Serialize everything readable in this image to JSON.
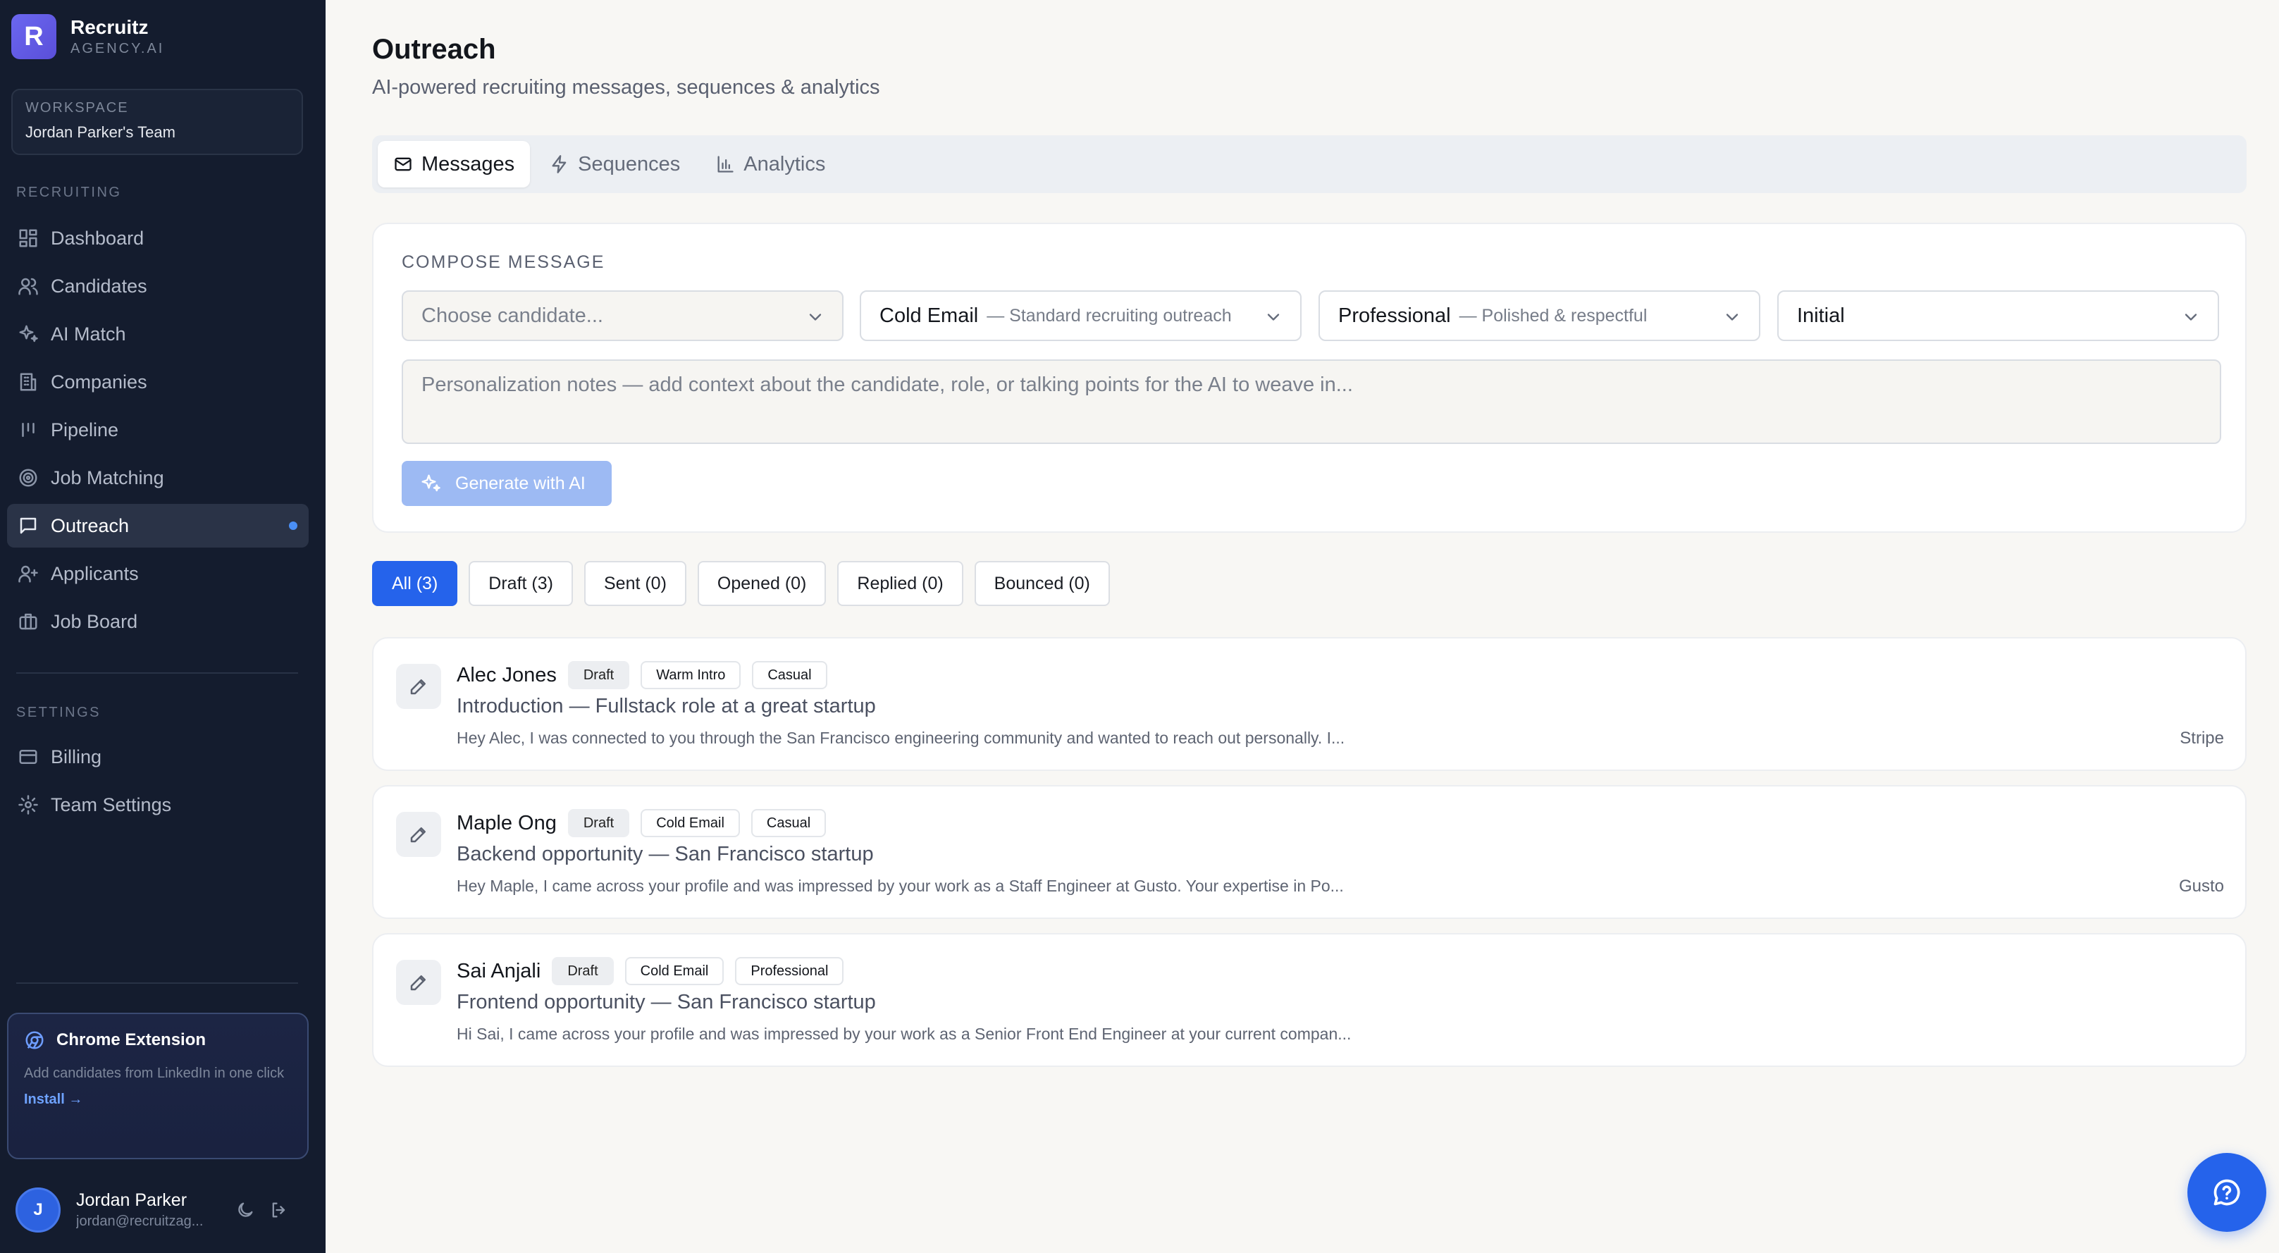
{
  "brand": {
    "name": "Recruitz",
    "sub": "AGENCY.AI",
    "logo_letter": "R"
  },
  "workspace": {
    "label": "WORKSPACE",
    "name": "Jordan Parker's Team"
  },
  "sidebar": {
    "recruiting_label": "RECRUITING",
    "recruiting_items": [
      {
        "label": "Dashboard",
        "icon": "dashboard-icon"
      },
      {
        "label": "Candidates",
        "icon": "users-icon"
      },
      {
        "label": "AI Match",
        "icon": "sparkles-icon"
      },
      {
        "label": "Companies",
        "icon": "building-icon"
      },
      {
        "label": "Pipeline",
        "icon": "kanban-icon"
      },
      {
        "label": "Job Matching",
        "icon": "target-icon"
      },
      {
        "label": "Outreach",
        "icon": "message-icon",
        "active": true
      },
      {
        "label": "Applicants",
        "icon": "user-plus-icon"
      },
      {
        "label": "Job Board",
        "icon": "briefcase-icon"
      }
    ],
    "settings_label": "SETTINGS",
    "settings_items": [
      {
        "label": "Billing",
        "icon": "credit-card-icon"
      },
      {
        "label": "Team Settings",
        "icon": "gear-icon"
      }
    ]
  },
  "extension": {
    "title": "Chrome Extension",
    "description": "Add candidates from LinkedIn in one click",
    "install_label": "Install →"
  },
  "user": {
    "initial": "J",
    "name": "Jordan Parker",
    "email": "jordan@recruitzag..."
  },
  "page": {
    "title": "Outreach",
    "subtitle": "AI-powered recruiting messages, sequences & analytics"
  },
  "tabs": [
    {
      "label": "Messages",
      "icon": "mail-icon",
      "active": true
    },
    {
      "label": "Sequences",
      "icon": "zap-icon"
    },
    {
      "label": "Analytics",
      "icon": "bar-chart-icon"
    }
  ],
  "compose": {
    "label": "COMPOSE MESSAGE",
    "candidate_placeholder": "Choose candidate...",
    "type_value": "Cold Email",
    "type_hint": "— Standard recruiting outreach",
    "tone_value": "Professional",
    "tone_hint": "— Polished & respectful",
    "stage_value": "Initial",
    "notes_placeholder": "Personalization notes — add context about the candidate, role, or talking points for the AI to weave in...",
    "generate_label": "Generate with AI"
  },
  "filters": [
    "All (3)",
    "Draft (3)",
    "Sent (0)",
    "Opened (0)",
    "Replied (0)",
    "Bounced (0)"
  ],
  "messages": [
    {
      "name": "Alec Jones",
      "status": "Draft",
      "type": "Warm Intro",
      "tone": "Casual",
      "subject": "Introduction — Fullstack role at a great startup",
      "preview": "Hey Alec, I was connected to you through the San Francisco engineering community and wanted to reach out personally. I...",
      "company": "Stripe"
    },
    {
      "name": "Maple Ong",
      "status": "Draft",
      "type": "Cold Email",
      "tone": "Casual",
      "subject": "Backend opportunity — San Francisco startup",
      "preview": "Hey Maple, I came across your profile and was impressed by your work as a Staff Engineer at Gusto. Your expertise in Po...",
      "company": "Gusto"
    },
    {
      "name": "Sai Anjali",
      "status": "Draft",
      "type": "Cold Email",
      "tone": "Professional",
      "subject": "Frontend opportunity — San Francisco startup",
      "preview": "Hi Sai, I came across your profile and was impressed by your work as a Senior Front End Engineer at your current compan...",
      "company": ""
    }
  ],
  "colors": {
    "sidebar_bg": "#141c2e",
    "accent": "#2563eb",
    "brand": "#6b67f0"
  }
}
